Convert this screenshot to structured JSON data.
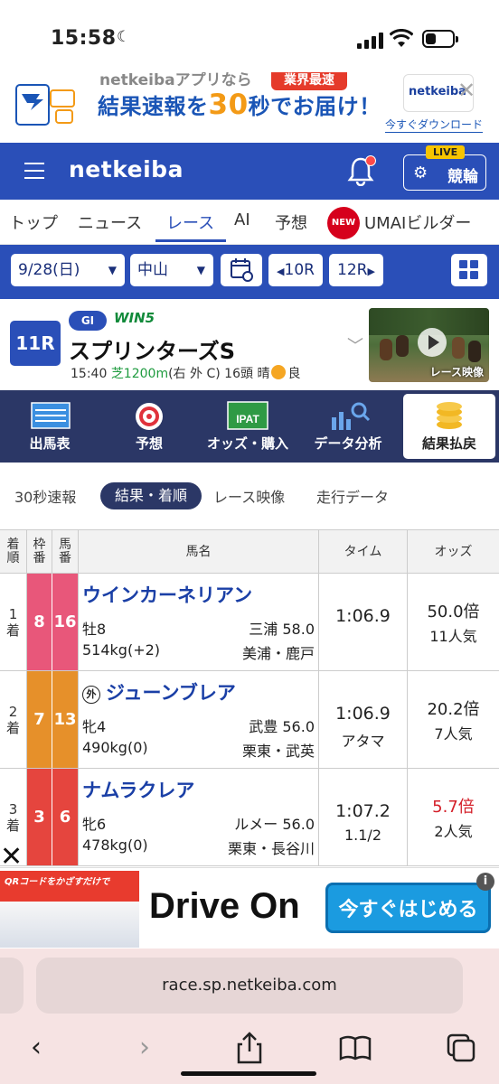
{
  "status_bar": {
    "time": "15:58"
  },
  "ad_top": {
    "line1": "netkeibaアプリなら",
    "tag": "業界最速",
    "line2_a": "結果速報を",
    "line2_num": "30",
    "line2_b": "秒でお届け！",
    "app_logo": "netkeiba",
    "download": "今すぐダウンロード"
  },
  "header": {
    "logo": "netkeiba",
    "live_badge": "LIVE",
    "keirin_label": "競輪"
  },
  "nav": {
    "items": [
      "トップ",
      "ニュース",
      "レース",
      "AI",
      "予想",
      "UMAIビルダー"
    ],
    "new_badge": "NEW",
    "active": "レース"
  },
  "selector": {
    "date": "9/28(日)",
    "course": "中山",
    "prev": "10R",
    "next": "12R"
  },
  "race": {
    "number": "11R",
    "grade": "GI",
    "win5": "WIN5",
    "name": "スプリンターズS",
    "time": "15:40",
    "surface": "芝1200m",
    "course_detail": "(右 外 C)",
    "heads": "16頭",
    "weather": "晴",
    "condition": "良",
    "video_label": "レース映像"
  },
  "icon_menu": [
    "出馬表",
    "予想",
    "オッズ・購入",
    "データ分析",
    "結果払戻"
  ],
  "subtabs": [
    "30秒速報",
    "結果・着順",
    "レース映像",
    "走行データ"
  ],
  "table": {
    "headers": {
      "rank": "着順",
      "waku": "枠番",
      "uma": "馬番",
      "name": "馬名",
      "time": "タイム",
      "odds": "オッズ"
    },
    "rows": [
      {
        "rank": "1着",
        "waku": "8",
        "uma": "16",
        "name": "ウインカーネリアン",
        "foreign": "",
        "sex_age": "牡8",
        "jockey": "三浦 58.0",
        "weight": "514kg(+2)",
        "trainer": "美浦・鹿戸",
        "time": "1:06.9",
        "margin": "",
        "odds": "50.0倍",
        "pop": "11人気",
        "waku_color": "#e8577a",
        "odds_color": "#222"
      },
      {
        "rank": "2着",
        "waku": "7",
        "uma": "13",
        "name": "ジューンブレア",
        "foreign": "外",
        "sex_age": "牝4",
        "jockey": "武豊 56.0",
        "weight": "490kg(0)",
        "trainer": "栗東・武英",
        "time": "1:06.9",
        "margin": "アタマ",
        "odds": "20.2倍",
        "pop": "7人気",
        "waku_color": "#e6902a",
        "odds_color": "#222"
      },
      {
        "rank": "3着",
        "waku": "3",
        "uma": "6",
        "name": "ナムラクレア",
        "foreign": "",
        "sex_age": "牝6",
        "jockey": "ルメー 56.0",
        "weight": "478kg(0)",
        "trainer": "栗東・長谷川",
        "time": "1:07.2",
        "margin": "1.1/2",
        "odds": "5.7倍",
        "pop": "2人気",
        "waku_color": "#e5453e",
        "odds_color": "#d4202a"
      }
    ]
  },
  "ad_bottom": {
    "qr_text": "QRコードをかざすだけで",
    "headline": "Drive On",
    "cta": "今すぐはじめる"
  },
  "safari": {
    "url": "race.sp.netkeiba.com"
  }
}
